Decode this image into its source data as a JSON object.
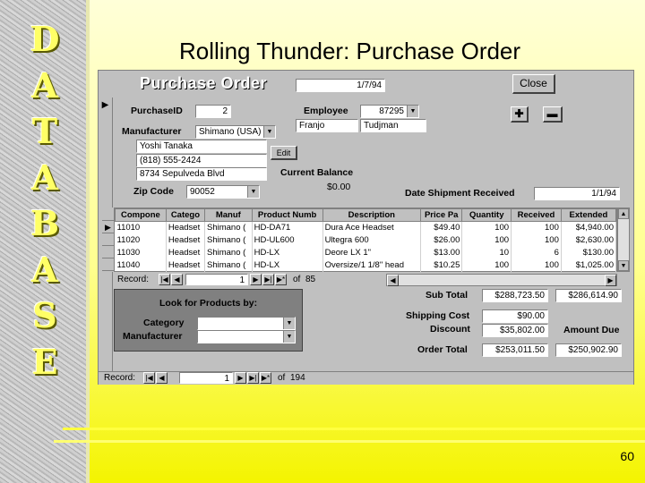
{
  "slide": {
    "title": "Rolling Thunder: Purchase Order",
    "side_letters": [
      "D",
      "A",
      "T",
      "A",
      "B",
      "A",
      "S",
      "E"
    ],
    "page_number": "60"
  },
  "form": {
    "title": "Purchase Order",
    "order_date": "1/7/94",
    "close_label": "Close",
    "purchase_id_label": "PurchaseID",
    "purchase_id": "2",
    "employee_label": "Employee",
    "employee_id": "87295",
    "employee_first": "Franjo",
    "employee_last": "Tudjman",
    "manufacturer_label": "Manufacturer",
    "manufacturer": "Shimano (USA)",
    "contact": "Yoshi Tanaka",
    "phone": "(818) 555-2424",
    "address": "8734 Sepulveda Blvd",
    "edit_label": "Edit",
    "current_balance_label": "Current Balance",
    "current_balance": "$0.00",
    "zip_label": "Zip Code",
    "zip": "90052",
    "date_received_label": "Date Shipment Received",
    "date_received": "1/1/94",
    "grid": {
      "columns": [
        "Compone",
        "Catego",
        "Manuf",
        "Product Numb",
        "Description",
        "Price Pa",
        "Quantity",
        "Received",
        "Extended"
      ],
      "rows": [
        [
          "11010",
          "Headset",
          "Shimano (",
          "HD-DA71",
          "Dura Ace Headset",
          "$49.40",
          "100",
          "100",
          "$4,940.00"
        ],
        [
          "11020",
          "Headset",
          "Shimano (",
          "HD-UL600",
          "Ultegra 600",
          "$26.00",
          "100",
          "100",
          "$2,630.00"
        ],
        [
          "11030",
          "Headset",
          "Shimano (",
          "HD-LX",
          "Deore LX 1\"",
          "$13.00",
          "10",
          "6",
          "$130.00"
        ],
        [
          "11040",
          "Headset",
          "Shimano (",
          "HD-LX",
          "Oversize/1 1/8\" head",
          "$10.25",
          "100",
          "100",
          "$1,025.00"
        ]
      ],
      "record_label": "Record:",
      "record_current": "1",
      "record_of": "of",
      "record_total": "85"
    },
    "lookup": {
      "title": "Look for Products by:",
      "category_label": "Category",
      "manufacturer_label": "Manufacturer",
      "category_value": "",
      "manufacturer_value": ""
    },
    "totals": {
      "subtotal_label": "Sub Total",
      "subtotal": "$288,723.50",
      "subtotal_right": "$286,614.90",
      "shipping_label": "Shipping Cost",
      "shipping": "$90.00",
      "discount_label": "Discount",
      "discount": "$35,802.00",
      "amount_due_label": "Amount Due",
      "order_total_label": "Order Total",
      "order_total": "$253,011.50",
      "amount_due": "$250,902.90"
    },
    "main_nav": {
      "record_label": "Record:",
      "record_current": "1",
      "record_of": "of",
      "record_total": "194"
    }
  }
}
